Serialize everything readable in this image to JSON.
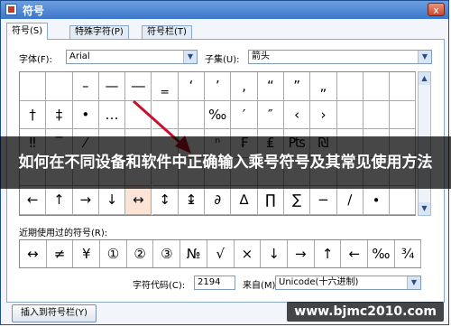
{
  "window": {
    "title": "符号",
    "close_label": "x"
  },
  "tabs": [
    {
      "label": "符号(S)",
      "active": true
    },
    {
      "label": "特殊字符(P)",
      "active": false
    },
    {
      "label": "符号栏(T)",
      "active": false
    }
  ],
  "font": {
    "label": "字体(F):",
    "value": "Arial"
  },
  "subset": {
    "label": "子集(U):",
    "value": "箭头"
  },
  "symbols": [
    [
      "",
      "",
      "–",
      "—",
      "―",
      "‗",
      "‘",
      "’",
      "‚",
      "“",
      "”",
      "„"
    ],
    [
      "†",
      "‡",
      "•",
      "…",
      "",
      "",
      "",
      "‰",
      "′",
      "″",
      "‹",
      "›"
    ],
    [
      "‼",
      "‾",
      "⁄",
      "",
      "",
      "",
      "",
      "ⁿ",
      "₣",
      "₤",
      "₧",
      "₪"
    ],
    [
      "",
      "",
      "",
      "",
      "",
      "",
      "",
      "",
      "",
      "",
      "",
      ""
    ],
    [
      "←",
      "↑",
      "→",
      "↓",
      "↔",
      "↕",
      "↨",
      "∂",
      "∆",
      "∏",
      "∑",
      "−",
      "∕",
      "∙"
    ]
  ],
  "recent": {
    "label": "近期使用过的符号(R):",
    "items": [
      "↔",
      "≠",
      "¥",
      "①",
      "②",
      "③",
      "№",
      "√",
      "×",
      "↓",
      "→",
      "↑",
      "←",
      "‰",
      "¾"
    ]
  },
  "char_code": {
    "label": "字符代码(C):",
    "value": "2194"
  },
  "from": {
    "label": "来自(M)",
    "value": "Unicode(十六进制)"
  },
  "insert_button": "插入到符号栏(Y)",
  "overlay_text": "如何在不同设备和软件中正确输入乘号符号及其常见使用方法",
  "watermark": "www.bjmc2010.com",
  "colors": {
    "title_bar": "#3d76c9",
    "selected_cell": "#fbe3d6",
    "arrow": "#c8102e"
  }
}
